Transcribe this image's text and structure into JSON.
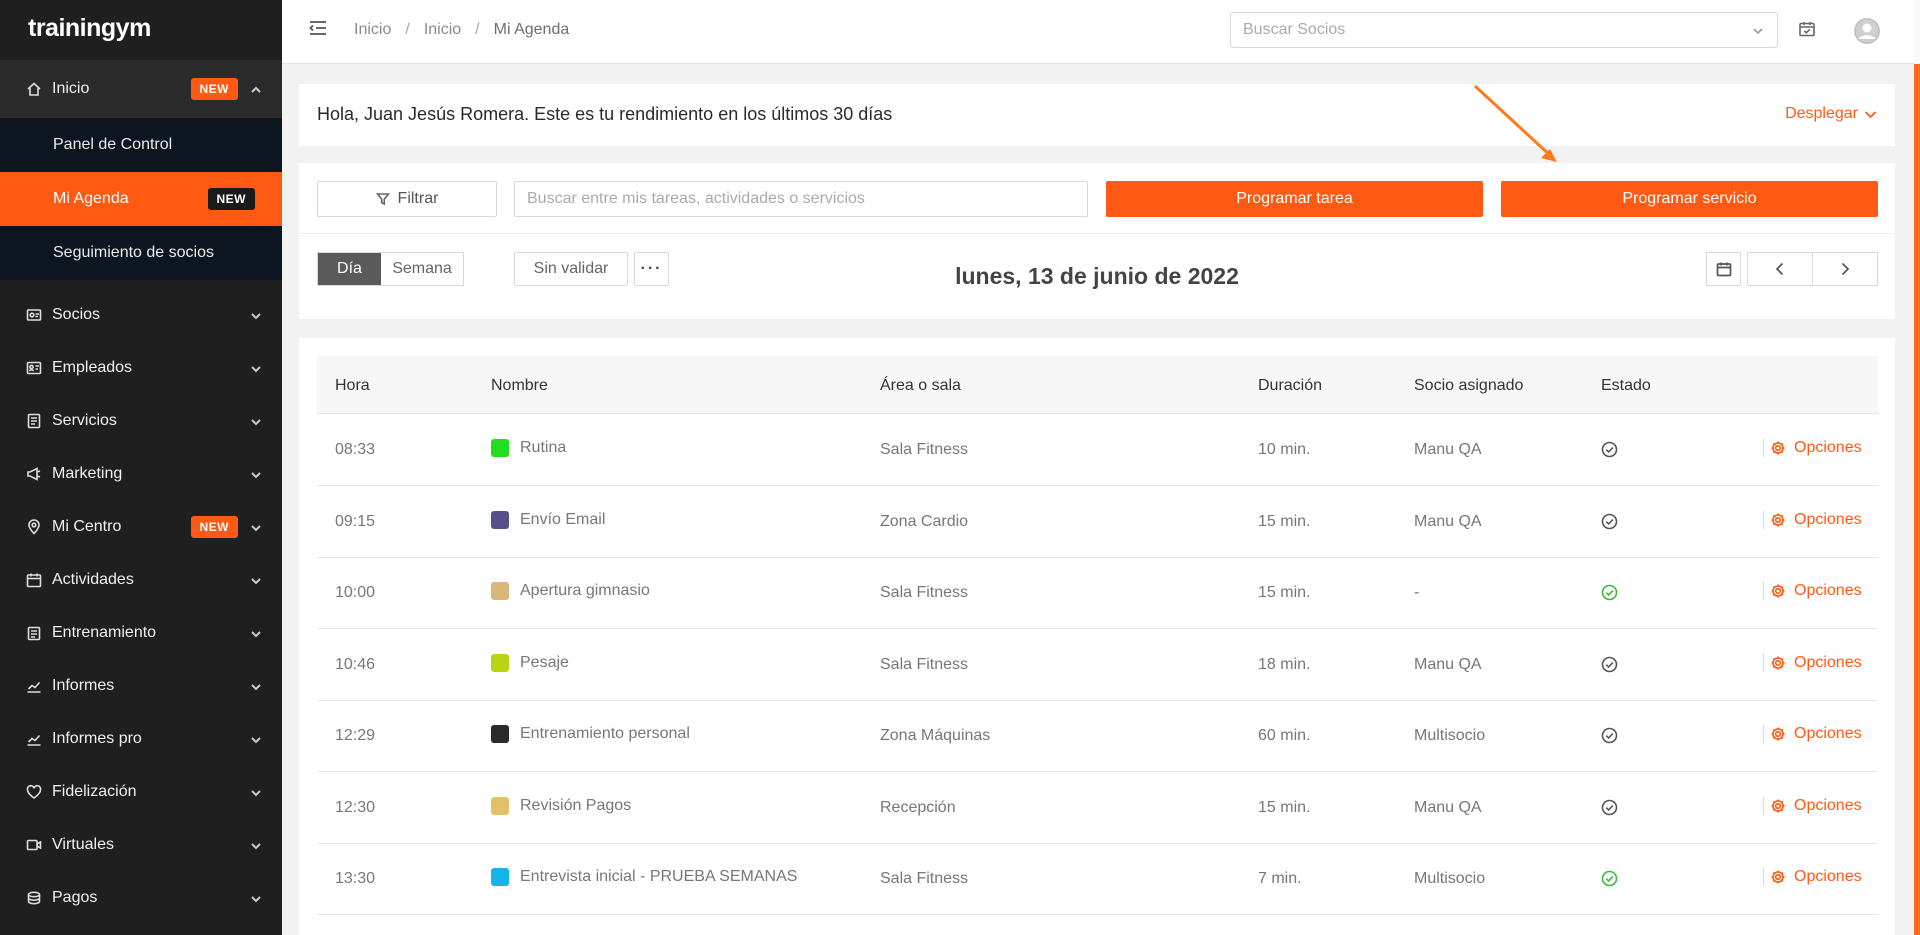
{
  "app": {
    "logo": "trainingym"
  },
  "sidebar": {
    "inicio": {
      "label": "Inicio",
      "badge": "NEW"
    },
    "submenu": [
      {
        "label": "Panel de Control"
      },
      {
        "label": "Mi Agenda",
        "badge": "NEW"
      },
      {
        "label": "Seguimiento de socios"
      }
    ],
    "items": [
      {
        "label": "Socios",
        "icon": "id-card-icon"
      },
      {
        "label": "Empleados",
        "icon": "badge-icon"
      },
      {
        "label": "Servicios",
        "icon": "list-icon"
      },
      {
        "label": "Marketing",
        "icon": "megaphone-icon"
      },
      {
        "label": "Mi Centro",
        "icon": "location-pin-icon",
        "badge": "NEW"
      },
      {
        "label": "Actividades",
        "icon": "calendar-icon"
      },
      {
        "label": "Entrenamiento",
        "icon": "clipboard-icon"
      },
      {
        "label": "Informes",
        "icon": "chart-line-icon"
      },
      {
        "label": "Informes pro",
        "icon": "chart-line-icon"
      },
      {
        "label": "Fidelización",
        "icon": "heart-icon"
      },
      {
        "label": "Virtuales",
        "icon": "video-icon"
      },
      {
        "label": "Pagos",
        "icon": "coins-icon"
      }
    ]
  },
  "topbar": {
    "breadcrumb": [
      "Inicio",
      "Inicio",
      "Mi Agenda"
    ],
    "search_placeholder": "Buscar Socios"
  },
  "greeting": {
    "text": "Hola, Juan Jesús Romera. Este es tu rendimiento en los últimos 30 días",
    "expand_label": "Desplegar"
  },
  "controls": {
    "filter_label": "Filtrar",
    "search_placeholder": "Buscar entre mis tareas, actividades o servicios",
    "schedule_task_label": "Programar tarea",
    "schedule_service_label": "Programar servicio",
    "view_day": "Día",
    "view_week": "Semana",
    "unvalidated_label": "Sin validar",
    "more_label": "···",
    "date_title": "lunes, 13 de junio de 2022"
  },
  "table": {
    "headers": [
      "Hora",
      "Nombre",
      "Área o sala",
      "Duración",
      "Socio asignado",
      "Estado"
    ],
    "options_label": "Opciones",
    "rows": [
      {
        "hora": "08:33",
        "nombre": "Rutina",
        "color": "#22dd22",
        "area": "Sala Fitness",
        "duracion": "10 min.",
        "socio": "Manu QA",
        "estado": "pending"
      },
      {
        "hora": "09:15",
        "nombre": "Envío Email",
        "color": "#56508a",
        "area": "Zona Cardio",
        "duracion": "15 min.",
        "socio": "Manu QA",
        "estado": "pending"
      },
      {
        "hora": "10:00",
        "nombre": "Apertura gimnasio",
        "color": "#d9b77a",
        "area": "Sala Fitness",
        "duracion": "15 min.",
        "socio": "-",
        "estado": "done"
      },
      {
        "hora": "10:46",
        "nombre": "Pesaje",
        "color": "#b7d611",
        "area": "Sala Fitness",
        "duracion": "18 min.",
        "socio": "Manu QA",
        "estado": "pending"
      },
      {
        "hora": "12:29",
        "nombre": "Entrenamiento personal",
        "color": "#2a2a2a",
        "area": "Zona Máquinas",
        "duracion": "60 min.",
        "socio": "Multisocio",
        "estado": "pending"
      },
      {
        "hora": "12:30",
        "nombre": "Revisión Pagos",
        "color": "#e2c16a",
        "area": "Recepción",
        "duracion": "15 min.",
        "socio": "Manu QA",
        "estado": "pending"
      },
      {
        "hora": "13:30",
        "nombre": "Entrevista inicial - PRUEBA SEMANAS",
        "color": "#14b4e6",
        "area": "Sala Fitness",
        "duracion": "7 min.",
        "socio": "Multisocio",
        "estado": "done"
      }
    ]
  },
  "colors": {
    "accent": "#ff5a14",
    "sidebar_bg": "#1f1f1f",
    "submenu_bg": "#0d1620",
    "status_done": "#3cb93c",
    "status_pending": "#555555"
  }
}
